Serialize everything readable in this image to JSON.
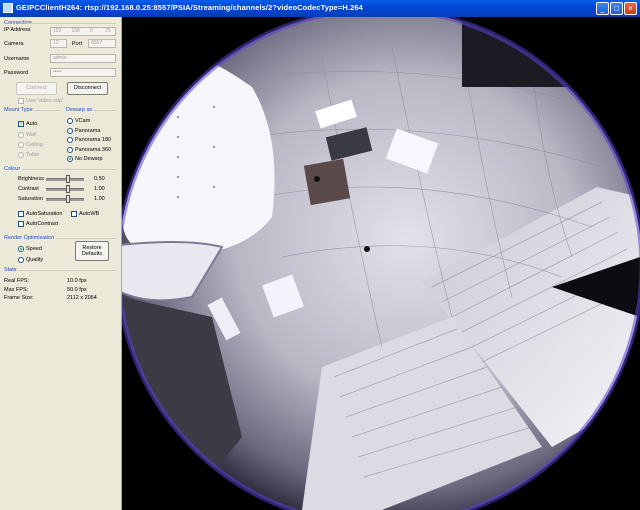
{
  "window": {
    "title": "GEIPCClientH264:  rtsp://192.168.0.25:8557/PSIA/Streaming/channels/2?videoCodecType=H.264"
  },
  "connection": {
    "section": "Connection",
    "ip_label": "IP Address",
    "ip_octets": [
      "192",
      "168",
      "0",
      "25"
    ],
    "camera_label": "Camera",
    "camera_value": "13",
    "port_label": "Port",
    "port_value": "8557",
    "username_label": "Username",
    "username_value": "admin",
    "password_label": "Password",
    "password_value": "•••••",
    "connect_label": "Connect",
    "disconnect_label": "Disconnect",
    "use_xdp_label": "Use 'video.xdp'"
  },
  "mount_type": {
    "section": "Mount Type",
    "auto_label": "Auto",
    "options": [
      "Wall",
      "Ceiling",
      "Table"
    ]
  },
  "dewarp": {
    "section": "Dewarp as",
    "options": [
      "VCam",
      "Panorama",
      "Panorama 180",
      "Panorama 360",
      "No Dewarp"
    ],
    "selected": "No Dewarp"
  },
  "colour": {
    "section": "Colour",
    "brightness_label": "Brightness",
    "brightness_value": "0.50",
    "contrast_label": "Contrast",
    "contrast_value": "1.00",
    "saturation_label": "Saturation",
    "saturation_value": "1.00",
    "auto_saturation_label": "AutoSaturation",
    "auto_wb_label": "AutoWB",
    "auto_contrast_label": "AutoContrast"
  },
  "render": {
    "section": "Render Optimisation",
    "speed_label": "Speed",
    "quality_label": "Quality",
    "selected": "Speed",
    "restore_label_1": "Restore",
    "restore_label_2": "Defaults"
  },
  "stats": {
    "section": "Stats",
    "real_fps_label": "Real FPS:",
    "real_fps_value": "10.0 fps",
    "max_fps_label": "Max FPS:",
    "max_fps_value": "50.0 fps",
    "frame_size_label": "Frame Size:",
    "frame_size_value": "2112 x 2064"
  },
  "colors": {
    "titlebar": "#0347d6",
    "panel_bg": "#ece9d8",
    "section_text": "#1c4fc3",
    "video_bg": "#000000"
  },
  "icons": [
    "app-icon",
    "minimize-icon",
    "maximize-icon",
    "close-icon"
  ]
}
